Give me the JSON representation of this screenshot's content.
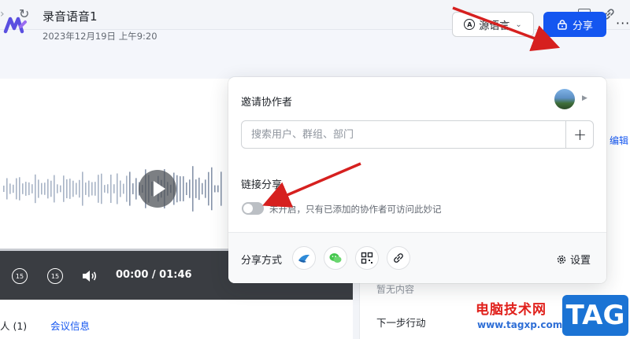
{
  "browser": {
    "reload_icon": "reload-icon",
    "window_icon": "window-icon",
    "link_icon": "link-icon"
  },
  "header": {
    "title": "录音语音1",
    "date": "2023年12月19日 上午9:20",
    "source_language_label": "源语言",
    "share_label": "分享",
    "more_label": "···"
  },
  "player": {
    "time": "00:00 / 01:46",
    "rewind_label": "15",
    "forward_label": "15"
  },
  "bottom_tabs": {
    "people": "人 (1)",
    "meeting_info": "会议信息"
  },
  "right_panel": {
    "edit": "编辑",
    "no_content": "暂无内容",
    "next_action": "下一步行动"
  },
  "share_popup": {
    "invite_title": "邀请协作者",
    "search_placeholder": "搜索用户、群组、部门",
    "add_label": "+",
    "link_share_title": "链接分享",
    "toggle_state": "off",
    "toggle_desc": "未开启，只有已添加的协作者可访问此妙记",
    "share_method_label": "分享方式",
    "methods": [
      "lark-icon",
      "wechat-icon",
      "qrcode-icon",
      "link-icon"
    ],
    "settings_label": "设置"
  },
  "watermark": {
    "text": "电脑技术网",
    "url": "www.tagxp.com",
    "tag": "TAG"
  },
  "colors": {
    "primary": "#1456f0",
    "annotation": "#d6201f",
    "control_bar": "#3a3d42"
  }
}
